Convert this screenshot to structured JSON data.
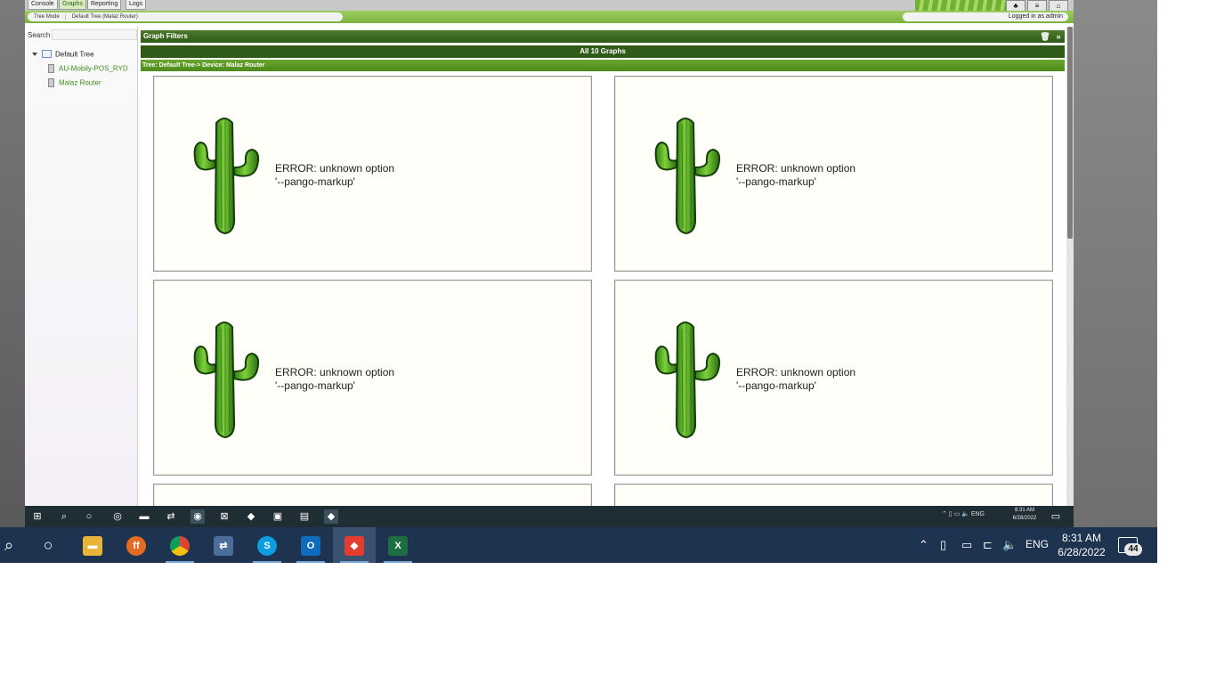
{
  "remote": {
    "top_tabs": [
      "Console",
      "Graphs",
      "Reporting",
      "Logs"
    ],
    "breadcrumbs": [
      "Tree Mode",
      "Default Tree (Malaz Router)"
    ],
    "login_text": "Logged in as admin",
    "search_label": "Search",
    "tree": {
      "root": "Default Tree",
      "devices": [
        "AU-Mobily-POS_RYD",
        "Malaz Router"
      ]
    },
    "graph_filters_title": "Graph Filters",
    "all_graphs": "All 10 Graphs",
    "path_prefix": "Tree: Default Tree-> Device: Malaz Router",
    "graph_error_line1": "ERROR: unknown option",
    "graph_error_line2": "'--pango-markup'",
    "inner_clock_time": "8:31 AM",
    "inner_clock_date": "6/28/2022",
    "inner_lang": "ENG"
  },
  "taskbar": {
    "lang": "ENG",
    "time": "8:31 AM",
    "date": "6/28/2022",
    "notifications": "44",
    "apps": [
      "file-explorer",
      "firefox",
      "chrome",
      "network-tool",
      "skype",
      "outlook",
      "anydesk",
      "excel"
    ]
  },
  "colors": {
    "cactus_green": "#3d9a22",
    "header_green": "#2f5a17",
    "taskbar": "#1e3350"
  }
}
